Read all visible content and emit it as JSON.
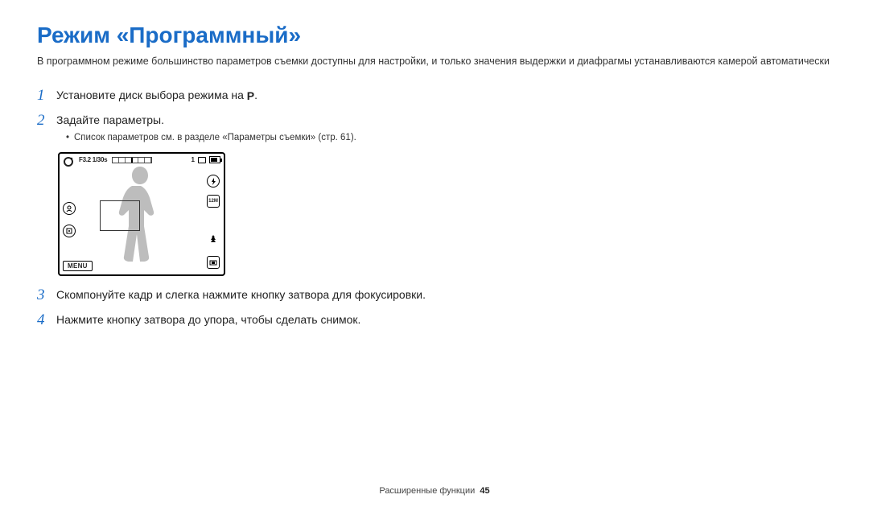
{
  "title": "Режим «Программный»",
  "intro": "В программном режиме большинство параметров съемки доступны для настройки, и только значения выдержки и диафрагмы устанавливаются камерой автоматически",
  "steps": {
    "s1": {
      "num": "1",
      "text_a": "Установите диск выбора режима на ",
      "icon": "P",
      "text_b": "."
    },
    "s2": {
      "num": "2",
      "text": "Задайте параметры.",
      "sub": "Список параметров см. в разделе «Параметры съемки» (стр. 61)."
    },
    "s3": {
      "num": "3",
      "text": "Скомпонуйте кадр и слегка нажмите кнопку затвора для фокусировки."
    },
    "s4": {
      "num": "4",
      "text": "Нажмите кнопку затвора до упора, чтобы сделать снимок."
    }
  },
  "figure": {
    "exposure": "F3.2 1/30s",
    "counter": "1",
    "menu": "MENU"
  },
  "footer": {
    "section": "Расширенные функции",
    "page": "45"
  }
}
